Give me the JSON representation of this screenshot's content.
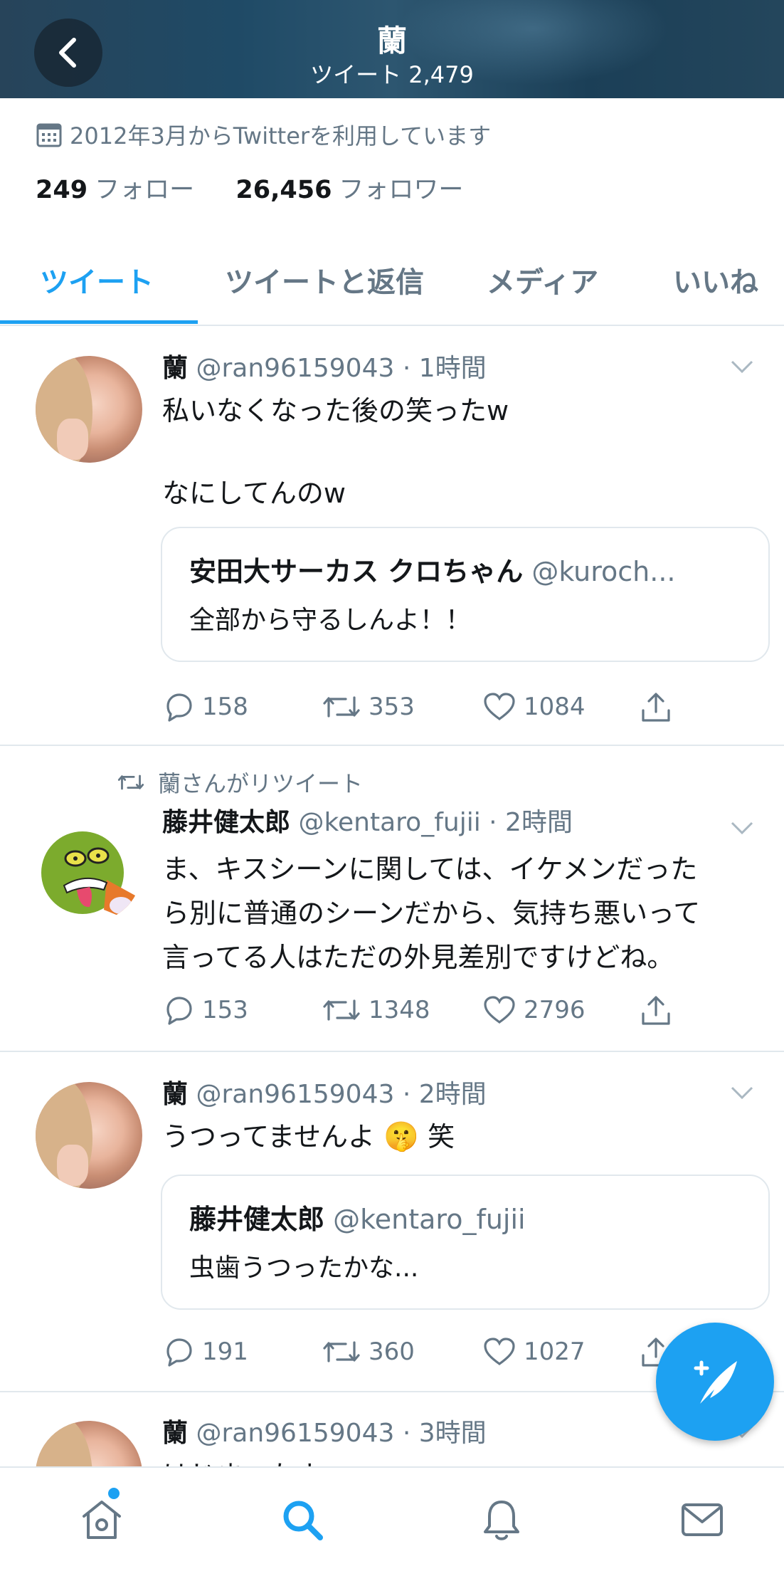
{
  "header": {
    "title": "蘭",
    "subtitle": "ツイート 2,479"
  },
  "profile": {
    "joined": "2012年3月からTwitterを利用しています",
    "following_count": "249",
    "following_label": "フォロー",
    "followers_count": "26,456",
    "followers_label": "フォロワー"
  },
  "tabs": [
    {
      "label": "ツイート",
      "active": true
    },
    {
      "label": "ツイートと返信",
      "active": false
    },
    {
      "label": "メディア",
      "active": false
    },
    {
      "label": "いいね",
      "active": false
    }
  ],
  "tweets": [
    {
      "name": "蘭",
      "handle": "@ran96159043",
      "time": "· 1時間",
      "body_line1": "私いなくなった後の笑ったw",
      "body_line2": "なにしてんのw",
      "quote": {
        "name": "安田大サーカス クロちゃん",
        "handle": "@kuroch...",
        "text": "全部から守るしんよ！！"
      },
      "replies": "158",
      "retweets": "353",
      "likes": "1084"
    },
    {
      "retweeted_by": "蘭さんがリツイート",
      "name": "藤井健太郎",
      "handle": "@kentaro_fujii",
      "time": "· 2時間",
      "body_line1": "ま、キスシーンに関しては、イケメンだった",
      "body_line2": "ら別に普通のシーンだから、気持ち悪いって",
      "body_line3": "言ってる人はただの外見差別ですけどね。",
      "replies": "153",
      "retweets": "1348",
      "likes": "2796"
    },
    {
      "name": "蘭",
      "handle": "@ran96159043",
      "time": "· 2時間",
      "body_text": "うつってませんよ",
      "body_emoji": "🤫",
      "body_suffix": "笑",
      "quote": {
        "name": "藤井健太郎",
        "handle": "@kentaro_fujii",
        "text": "虫歯うつったかな..."
      },
      "replies": "191",
      "retweets": "360",
      "likes": "1027"
    },
    {
      "name": "蘭",
      "handle": "@ran96159043",
      "time": "· 3時間",
      "body_partial": "はじまったよ"
    }
  ],
  "bottom_nav": [
    "home-icon",
    "search-icon",
    "bell-icon",
    "mail-icon"
  ],
  "colors": {
    "accent": "#1da1f2",
    "text": "#14171a",
    "muted": "#657786",
    "border": "#e1e8ed"
  }
}
